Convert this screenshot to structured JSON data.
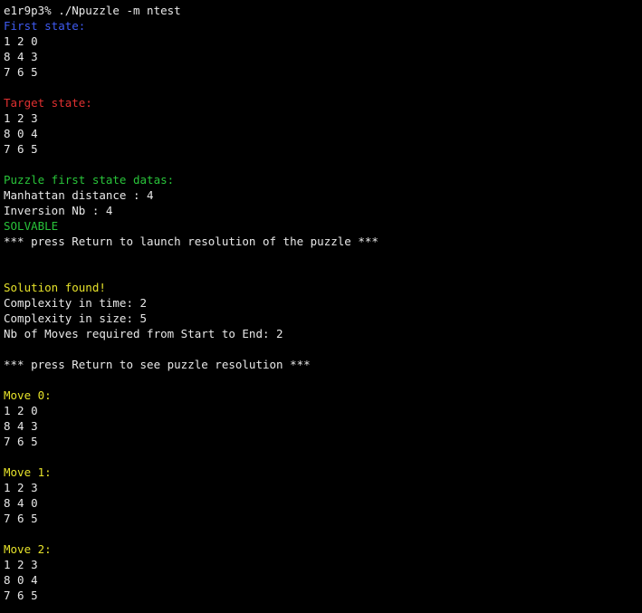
{
  "colors": {
    "background": "#000000",
    "text": "#e8e8e8",
    "first_state": "#3f5bf2",
    "target_state": "#e03030",
    "datas": "#29c43a",
    "solution": "#e6e22a"
  },
  "prompt": "e1r9p3% ./Npuzzle -m ntest",
  "first_state": {
    "label": "First state:",
    "rows": [
      "1 2 0",
      "8 4 3",
      "7 6 5"
    ]
  },
  "target_state": {
    "label": "Target state:",
    "rows": [
      "1 2 3",
      "8 0 4",
      "7 6 5"
    ]
  },
  "datas": {
    "label": "Puzzle first state datas:",
    "manhattan": "Manhattan distance : 4",
    "inversion": "Inversion Nb : 4",
    "solvable": "SOLVABLE",
    "press_launch": "*** press Return to launch resolution of the puzzle ***"
  },
  "solution": {
    "found": "Solution found!",
    "complexity_time": "Complexity in time: 2",
    "complexity_size": "Complexity in size: 5",
    "moves_required": "Nb of Moves required from Start to End: 2",
    "press_see": "*** press Return to see puzzle resolution ***"
  },
  "moves": [
    {
      "label": "Move 0:",
      "rows": [
        "1 2 0",
        "8 4 3",
        "7 6 5"
      ]
    },
    {
      "label": "Move 1:",
      "rows": [
        "1 2 3",
        "8 4 0",
        "7 6 5"
      ]
    },
    {
      "label": "Move 2:",
      "rows": [
        "1 2 3",
        "8 0 4",
        "7 6 5"
      ]
    }
  ]
}
